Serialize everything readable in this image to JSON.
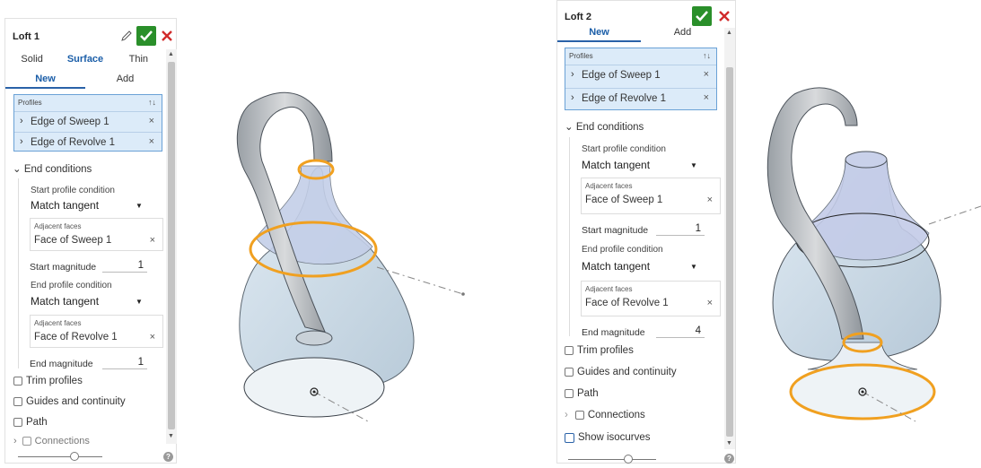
{
  "panel1": {
    "title": "Loft 1",
    "body_tabs": [
      "Solid",
      "Surface",
      "Thin"
    ],
    "mode_tabs": [
      "New",
      "Add"
    ],
    "profiles_label": "Profiles",
    "profiles": [
      "Edge of Sweep 1",
      "Edge of Revolve 1"
    ],
    "end_conditions_label": "End conditions",
    "start_profile_condition_label": "Start profile condition",
    "start_profile_condition_value": "Match tangent",
    "start_adjacent_faces_label": "Adjacent faces",
    "start_adjacent_faces_value": "Face of Sweep 1",
    "start_magnitude_label": "Start magnitude",
    "start_magnitude_value": "1",
    "end_profile_condition_label": "End profile condition",
    "end_profile_condition_value": "Match tangent",
    "end_adjacent_faces_label": "Adjacent faces",
    "end_adjacent_faces_value": "Face of Revolve 1",
    "end_magnitude_label": "End magnitude",
    "end_magnitude_value": "1",
    "trim_profiles": "Trim profiles",
    "guides": "Guides and continuity",
    "path": "Path",
    "connections": "Connections"
  },
  "panel2": {
    "title": "Loft 2",
    "mode_tabs": [
      "New",
      "Add"
    ],
    "profiles_label": "Profiles",
    "profiles": [
      "Edge of Sweep 1",
      "Edge of Revolve 1"
    ],
    "end_conditions_label": "End conditions",
    "start_profile_condition_label": "Start profile condition",
    "start_profile_condition_value": "Match tangent",
    "start_adjacent_faces_label": "Adjacent faces",
    "start_adjacent_faces_value": "Face of Sweep 1",
    "start_magnitude_label": "Start magnitude",
    "start_magnitude_value": "1",
    "end_profile_condition_label": "End profile condition",
    "end_profile_condition_value": "Match tangent",
    "end_adjacent_faces_label": "Adjacent faces",
    "end_adjacent_faces_value": "Face of Revolve 1",
    "end_magnitude_label": "End magnitude",
    "end_magnitude_value": "4",
    "trim_profiles": "Trim profiles",
    "guides": "Guides and continuity",
    "path": "Path",
    "connections": "Connections",
    "show_isocurves": "Show isocurves"
  },
  "icons": {
    "confirm": "check-icon",
    "cancel": "close-icon",
    "edit": "pencil-icon",
    "sort": "sort-icon",
    "help": "help-icon"
  },
  "colors": {
    "confirm": "#2a8f2a",
    "cancel": "#d12a2a",
    "accent": "#2a62a8",
    "selection_fill": "#dcebf9",
    "highlight_edge": "#f0a020"
  }
}
